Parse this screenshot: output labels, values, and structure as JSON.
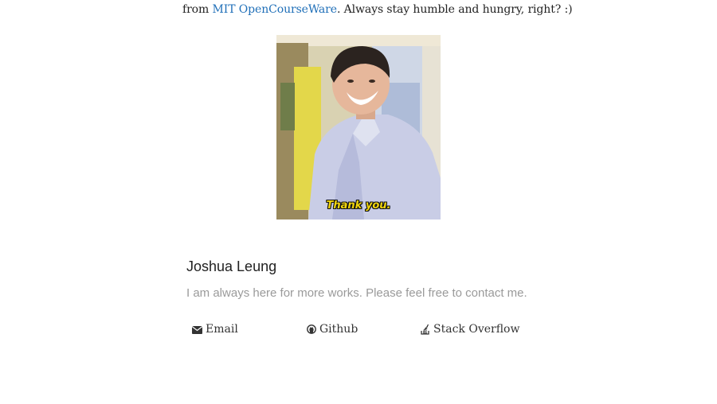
{
  "intro": {
    "prefix": "from ",
    "link_text": "MIT OpenCourseWare",
    "suffix": ". Always stay humble and hungry, right? :)"
  },
  "gif": {
    "caption": "Thank you."
  },
  "contact": {
    "name": "Joshua Leung",
    "description": "I am always here for more works. Please feel free to contact me.",
    "links": [
      {
        "label": "Email",
        "icon": "envelope-icon"
      },
      {
        "label": "Github",
        "icon": "github-icon"
      },
      {
        "label": "Stack Overflow",
        "icon": "stack-overflow-icon"
      }
    ]
  },
  "colors": {
    "link": "#1f6fb8",
    "muted_text": "#9a9a9a",
    "caption": "#f2d60d"
  }
}
